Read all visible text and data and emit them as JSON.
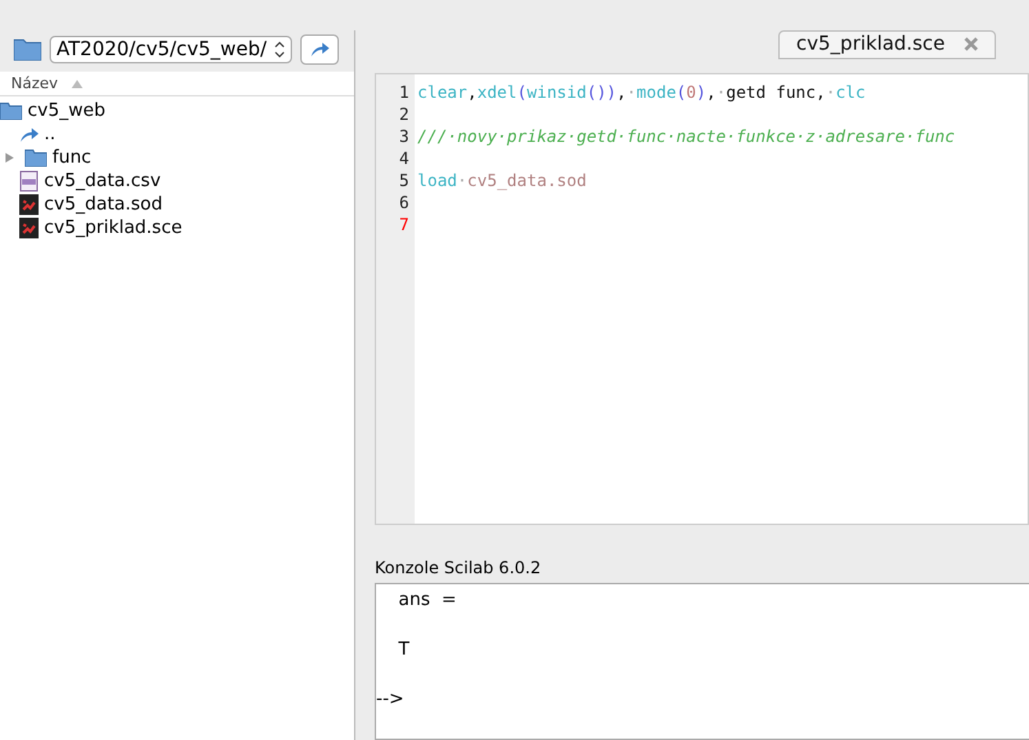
{
  "browser": {
    "path": "AT2020/cv5/cv5_web/",
    "column_header": "Název",
    "tree": [
      {
        "name": "cv5_web",
        "kind": "folder",
        "children": [
          {
            "name": "..",
            "kind": "up"
          },
          {
            "name": "func",
            "kind": "folder",
            "expanded": false
          },
          {
            "name": "cv5_data.csv",
            "kind": "csv"
          },
          {
            "name": "cv5_data.sod",
            "kind": "scilab"
          },
          {
            "name": "cv5_priklad.sce",
            "kind": "scilab"
          }
        ]
      }
    ]
  },
  "editor": {
    "tabs": [
      {
        "label": "cv5_priklad.sce",
        "selected": true
      }
    ],
    "lines": [
      {
        "number": "1",
        "current": false,
        "tokens": [
          {
            "text": "clear",
            "kind": "func"
          },
          {
            "text": ",",
            "kind": "plain"
          },
          {
            "text": "xdel",
            "kind": "func"
          },
          {
            "text": "(",
            "kind": "paren"
          },
          {
            "text": "winsid",
            "kind": "func"
          },
          {
            "text": "())",
            "kind": "paren"
          },
          {
            "text": ",",
            "kind": "plain"
          },
          {
            "text": "·",
            "kind": "space"
          },
          {
            "text": "mode",
            "kind": "func"
          },
          {
            "text": "(",
            "kind": "paren"
          },
          {
            "text": "0",
            "kind": "number"
          },
          {
            "text": ")",
            "kind": "paren"
          },
          {
            "text": ",",
            "kind": "plain"
          },
          {
            "text": "·",
            "kind": "space"
          },
          {
            "text": "getd func,",
            "kind": "plain"
          },
          {
            "text": "·",
            "kind": "space"
          },
          {
            "text": "clc",
            "kind": "func"
          }
        ]
      },
      {
        "number": "2",
        "current": false
      },
      {
        "number": "3",
        "current": false,
        "tokens": [
          {
            "text": "///·novy·prikaz·getd·func·nacte·funkce·z·adresare·func",
            "kind": "comment"
          }
        ]
      },
      {
        "number": "4",
        "current": false
      },
      {
        "number": "5",
        "current": false,
        "tokens": [
          {
            "text": "load",
            "kind": "func"
          },
          {
            "text": "·",
            "kind": "space"
          },
          {
            "text": "cv5_data.sod",
            "kind": "string"
          }
        ]
      },
      {
        "number": "6",
        "current": false
      },
      {
        "number": "7",
        "current": true
      }
    ]
  },
  "console": {
    "title": "Konzole Scilab 6.0.2",
    "lines": [
      "  ans  =",
      "  T"
    ],
    "prompt": "-->"
  }
}
